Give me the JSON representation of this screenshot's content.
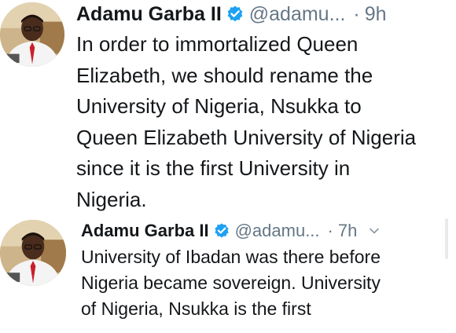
{
  "tweets": [
    {
      "author_name": "Adamu Garba II",
      "handle": "@adamu...",
      "dot": "·",
      "time": "9h",
      "lines": [
        "In order to immortalized Queen",
        "Elizabeth, we should rename the",
        "University of Nigeria, Nsukka to",
        "Queen Elizabeth University of Nigeria",
        "since it is the first University in",
        "Nigeria."
      ]
    },
    {
      "author_name": "Adamu Garba II",
      "handle": "@adamu...",
      "dot": "·",
      "time": "7h",
      "lines": [
        "University of Ibadan was there before",
        "Nigeria became sovereign. University",
        "of Nigeria, Nsukka is the first"
      ]
    }
  ],
  "colors": {
    "text": "#14171a",
    "secondary": "#657786",
    "verified": "#1da1f2",
    "background": "#ffffff"
  },
  "icons": {
    "verified": "verified-badge-icon",
    "menu": "chevron-down-icon"
  }
}
